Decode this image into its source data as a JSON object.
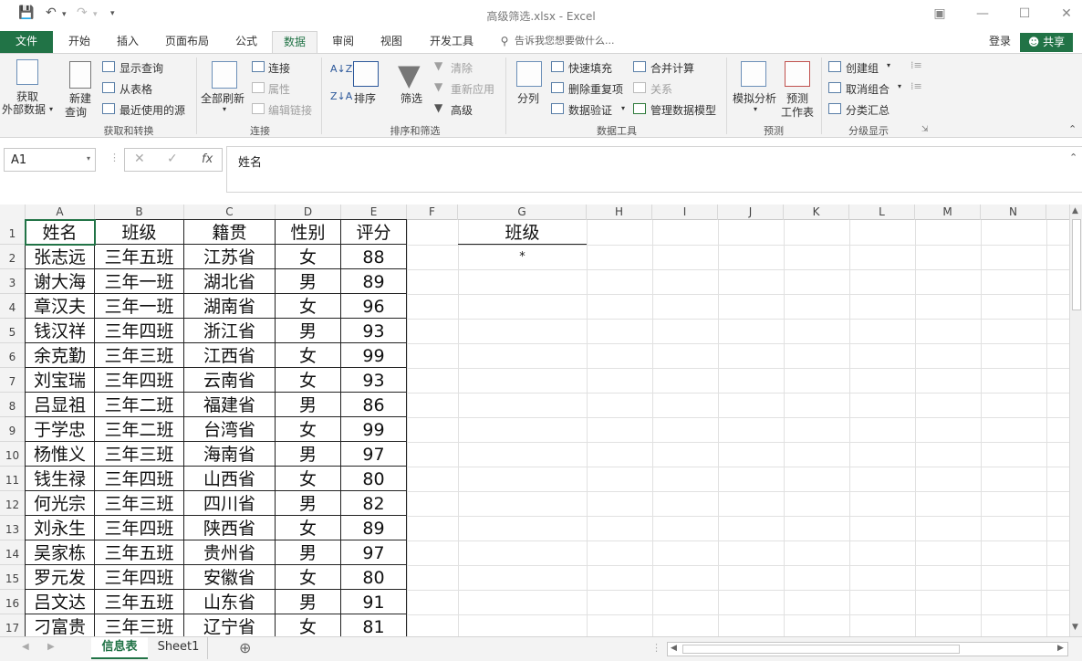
{
  "window": {
    "title": "高级筛选.xlsx - Excel"
  },
  "tabs": {
    "file": "文件",
    "items": [
      "开始",
      "插入",
      "页面布局",
      "公式",
      "数据",
      "审阅",
      "视图",
      "开发工具"
    ],
    "tell_me": "告诉我您想要做什么...",
    "signin": "登录",
    "share": "共享"
  },
  "ribbon": {
    "get_data": "获取",
    "get_data2": "外部数据",
    "new_query": "新建",
    "new_query2": "查询",
    "show_queries": "显示查询",
    "from_table": "从表格",
    "recent_sources": "最近使用的源",
    "group_get": "获取和转换",
    "refresh_all": "全部刷新",
    "connections": "连接",
    "properties": "属性",
    "edit_links": "编辑链接",
    "group_conn": "连接",
    "sort": "排序",
    "filter": "筛选",
    "clear": "清除",
    "reapply": "重新应用",
    "advanced": "高级",
    "group_sort": "排序和筛选",
    "text_to_col": "分列",
    "flash_fill": "快速填充",
    "remove_dup": "删除重复项",
    "validation": "数据验证",
    "consolidate": "合并计算",
    "relationships": "关系",
    "data_model": "管理数据模型",
    "group_tools": "数据工具",
    "whatif": "模拟分析",
    "forecast": "预测",
    "forecast2": "工作表",
    "group_forecast": "预测",
    "group_btn": "创建组",
    "ungroup": "取消组合",
    "subtotal": "分类汇总",
    "group_outline": "分级显示"
  },
  "formula_bar": {
    "name_box": "A1",
    "formula": "姓名",
    "fx": "fx"
  },
  "columns": [
    "A",
    "B",
    "C",
    "D",
    "E",
    "F",
    "G",
    "H",
    "I",
    "J",
    "K",
    "L",
    "M",
    "N"
  ],
  "headers": [
    "姓名",
    "班级",
    "籍贯",
    "性别",
    "评分"
  ],
  "rows": [
    [
      "张志远",
      "三年五班",
      "江苏省",
      "女",
      "88"
    ],
    [
      "谢大海",
      "三年一班",
      "湖北省",
      "男",
      "89"
    ],
    [
      "章汉夫",
      "三年一班",
      "湖南省",
      "女",
      "96"
    ],
    [
      "钱汉祥",
      "三年四班",
      "浙江省",
      "男",
      "93"
    ],
    [
      "余克勤",
      "三年三班",
      "江西省",
      "女",
      "99"
    ],
    [
      "刘宝瑞",
      "三年四班",
      "云南省",
      "女",
      "93"
    ],
    [
      "吕显祖",
      "三年二班",
      "福建省",
      "男",
      "86"
    ],
    [
      "于学忠",
      "三年二班",
      "台湾省",
      "女",
      "99"
    ],
    [
      "杨惟义",
      "三年三班",
      "海南省",
      "男",
      "97"
    ],
    [
      "钱生禄",
      "三年四班",
      "山西省",
      "女",
      "80"
    ],
    [
      "何光宗",
      "三年三班",
      "四川省",
      "男",
      "82"
    ],
    [
      "刘永生",
      "三年四班",
      "陕西省",
      "女",
      "89"
    ],
    [
      "吴家栋",
      "三年五班",
      "贵州省",
      "男",
      "97"
    ],
    [
      "罗元发",
      "三年四班",
      "安徽省",
      "女",
      "80"
    ],
    [
      "吕文达",
      "三年五班",
      "山东省",
      "男",
      "91"
    ],
    [
      "刁富贵",
      "三年三班",
      "辽宁省",
      "女",
      "81"
    ]
  ],
  "criteria": {
    "header": "班级",
    "value": "*"
  },
  "row_numbers": [
    "1",
    "2",
    "3",
    "4",
    "5",
    "6",
    "7",
    "8",
    "9",
    "10",
    "11",
    "12",
    "13",
    "14",
    "15",
    "16",
    "17"
  ],
  "sheets": [
    "信息表",
    "Sheet1"
  ],
  "colors": {
    "accent": "#217346"
  }
}
